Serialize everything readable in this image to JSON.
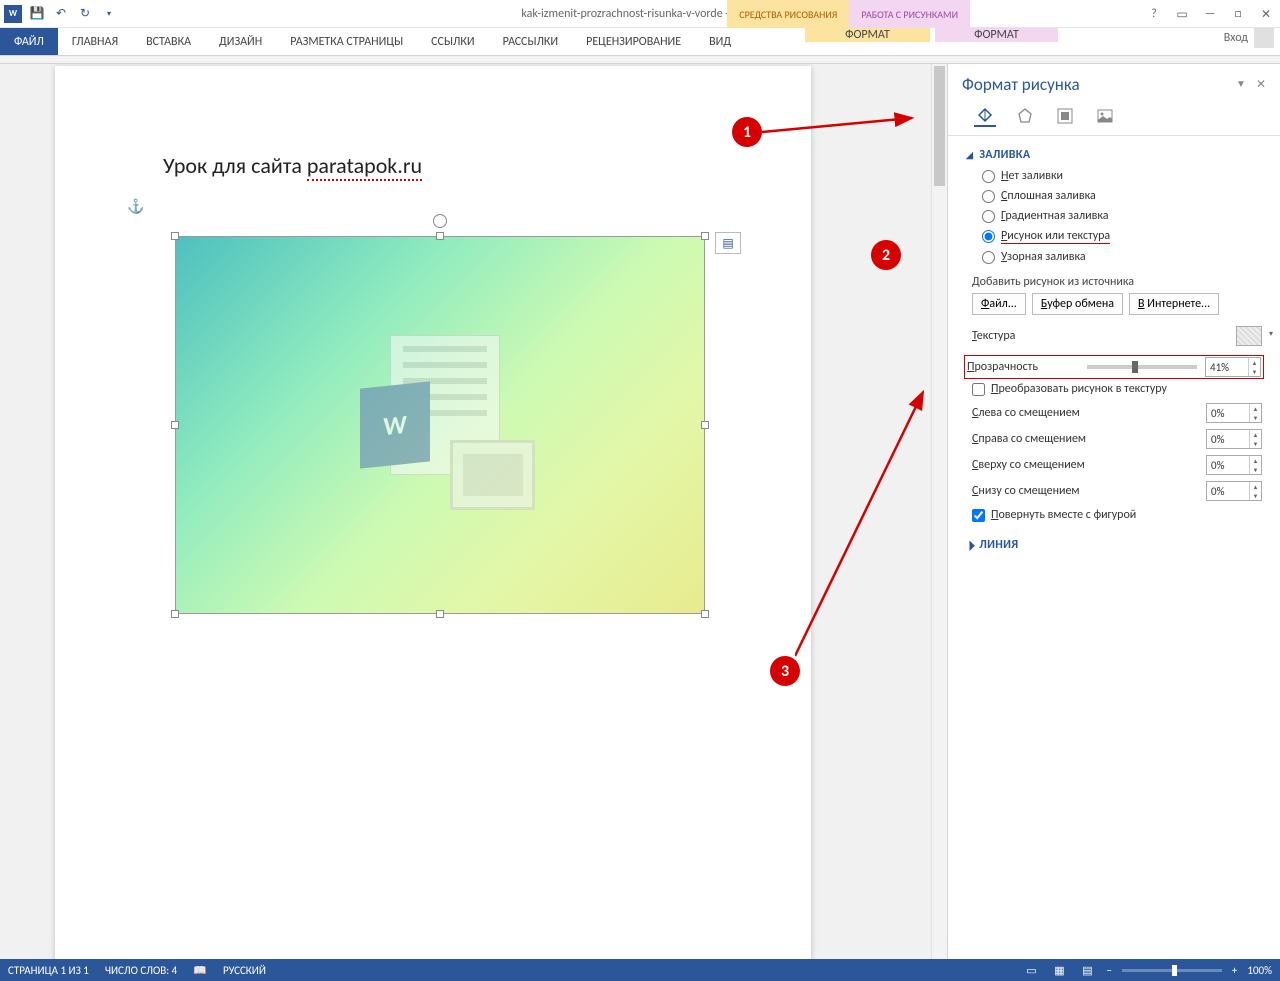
{
  "title_bar": {
    "doc_title": "kak-izmenit-prozrachnost-risunka-v-vorde - Word",
    "contextual_drawing": "СРЕДСТВА РИСОВАНИЯ",
    "contextual_picture": "РАБОТА С РИСУНКАМИ"
  },
  "ribbon": {
    "file": "ФАЙЛ",
    "home": "ГЛАВНАЯ",
    "insert": "ВСТАВКА",
    "design": "ДИЗАЙН",
    "layout": "РАЗМЕТКА СТРАНИЦЫ",
    "references": "ССЫЛКИ",
    "mailings": "РАССЫЛКИ",
    "review": "РЕЦЕНЗИРОВАНИЕ",
    "view": "ВИД",
    "format_drawing": "ФОРМАТ",
    "format_picture": "ФОРМАТ",
    "login": "Вход"
  },
  "page": {
    "text_left": "Урок для сайта ",
    "text_right": "paratapok.ru",
    "wm_letter": "W"
  },
  "pane": {
    "title": "Формат рисунка",
    "sec_fill": "ЗАЛИВКА",
    "fill_none": "Нет заливки",
    "fill_solid": "Сплошная заливка",
    "fill_gradient": "Градиентная заливка",
    "fill_picture": "Рисунок или текстура",
    "fill_pattern": "Узорная заливка",
    "add_from": "Добавить рисунок из источника",
    "btn_file": "Файл...",
    "btn_clip": "Буфер обмена",
    "btn_web": "В Интернете...",
    "texture": "Текстура",
    "transparency": "Прозрачность",
    "transparency_val": "41%",
    "tile": "Преобразовать рисунок в текстуру",
    "offset_left": "Слева со смещением",
    "offset_right": "Справа со смещением",
    "offset_top": "Сверху со смещением",
    "offset_bottom": "Снизу со смещением",
    "offset_val": "0%",
    "rotate_with": "Повернуть вместе с фигурой",
    "sec_line": "ЛИНИЯ"
  },
  "anno": {
    "n1": "1",
    "n2": "2",
    "n3": "3"
  },
  "status": {
    "page": "СТРАНИЦА 1 ИЗ 1",
    "words": "ЧИСЛО СЛОВ: 4",
    "lang": "РУССКИЙ",
    "zoom": "100%"
  }
}
